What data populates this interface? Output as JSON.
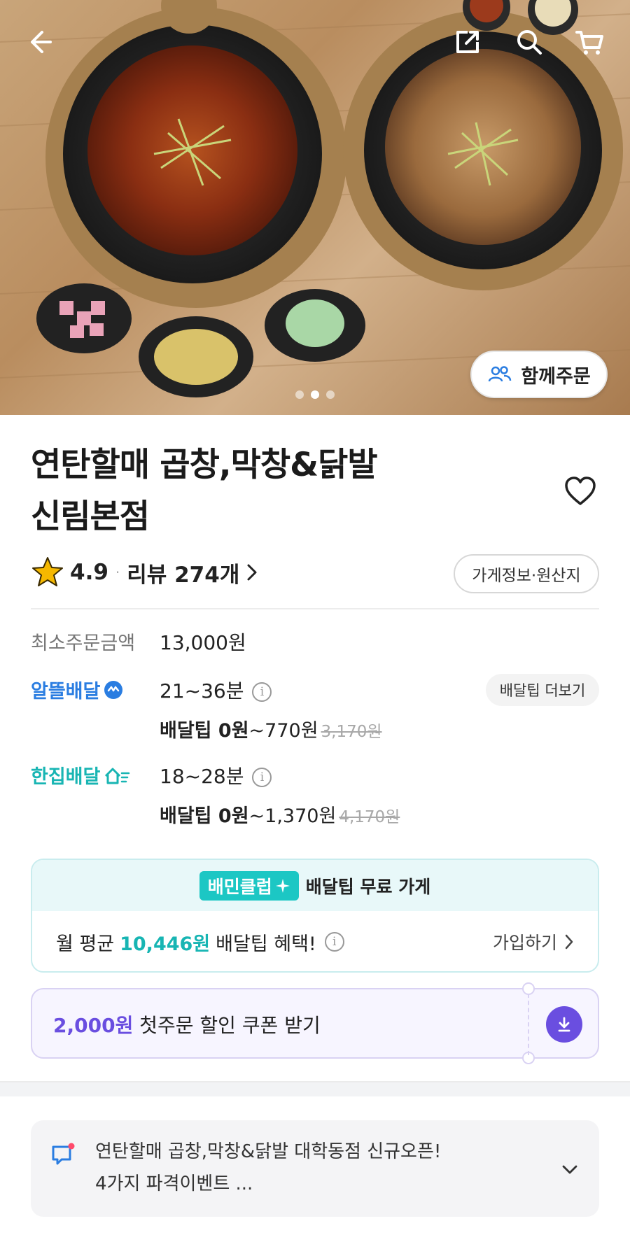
{
  "header": {
    "back_icon": "arrow-left-icon",
    "share_icon": "share-icon",
    "search_icon": "search-icon",
    "cart_icon": "cart-icon"
  },
  "hero": {
    "slide_count": 3,
    "active_slide": 2,
    "group_order_label": "함께주문"
  },
  "store": {
    "name_line1": "연탄할매 곱창,막창&닭발",
    "name_line2": "신림본점",
    "rating": "4.9",
    "review_label": "리뷰 274개",
    "info_button": "가게정보·원산지"
  },
  "details": {
    "min_order_label": "최소주문금액",
    "min_order_value": "13,000원",
    "more_tips_button": "배달팁 더보기",
    "options": [
      {
        "name": "알뜰배달",
        "color": "#2a7de1",
        "time": "21~36분",
        "tip_prefix": "배달팁 0원",
        "tip_range": "~770원",
        "tip_original": "3,170원"
      },
      {
        "name": "한집배달",
        "color": "#18b5b3",
        "time": "18~28분",
        "tip_prefix": "배달팁 0원",
        "tip_range": "~1,370원",
        "tip_original": "4,170원"
      }
    ]
  },
  "club": {
    "badge": "배민클럽",
    "title": "배달팁 무료 가게",
    "benefit_prefix": "월 평균",
    "benefit_amount": "10,446원",
    "benefit_suffix": "배달팁 혜택!",
    "join_label": "가입하기"
  },
  "coupon": {
    "amount": "2,000원",
    "text": "첫주문 할인 쿠폰 받기"
  },
  "notice": {
    "text": "연탄할매 곱창,막창&닭발 대학동점 신규오픈!\n4가지 파격이벤트 ..."
  },
  "colors": {
    "club_accent": "#1cc7c4",
    "coupon_accent": "#6a4ee0",
    "star": "#f5b800"
  }
}
